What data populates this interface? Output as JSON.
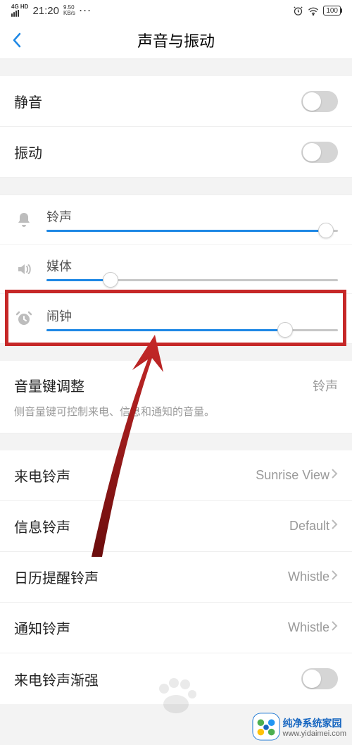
{
  "status_bar": {
    "network_type": "4G HD",
    "time": "21:20",
    "net_speed_top": "9.50",
    "net_speed_bottom": "KB/s",
    "battery": "100"
  },
  "nav": {
    "title": "声音与振动"
  },
  "toggles": {
    "mute": {
      "label": "静音",
      "on": false
    },
    "vibration": {
      "label": "振动",
      "on": false
    }
  },
  "sliders": {
    "ringtone": {
      "label": "铃声",
      "percent": 96
    },
    "media": {
      "label": "媒体",
      "percent": 22
    },
    "alarm": {
      "label": "闹钟",
      "percent": 82
    }
  },
  "volume_key": {
    "label": "音量键调整",
    "value": "铃声",
    "help": "侧音量键可控制来电、信息和通知的音量。"
  },
  "ringtones": {
    "incoming": {
      "label": "来电铃声",
      "value": "Sunrise View"
    },
    "message": {
      "label": "信息铃声",
      "value": "Default"
    },
    "calendar": {
      "label": "日历提醒铃声",
      "value": "Whistle"
    },
    "notification": {
      "label": "通知铃声",
      "value": "Whistle"
    },
    "crescendo": {
      "label": "来电铃声渐强",
      "on": false
    }
  },
  "annotation": {
    "highlight_target": "alarm",
    "arrow_color": "#a01515"
  },
  "watermark": {
    "title": "纯净系统家园",
    "url": "www.yidaimei.com"
  }
}
